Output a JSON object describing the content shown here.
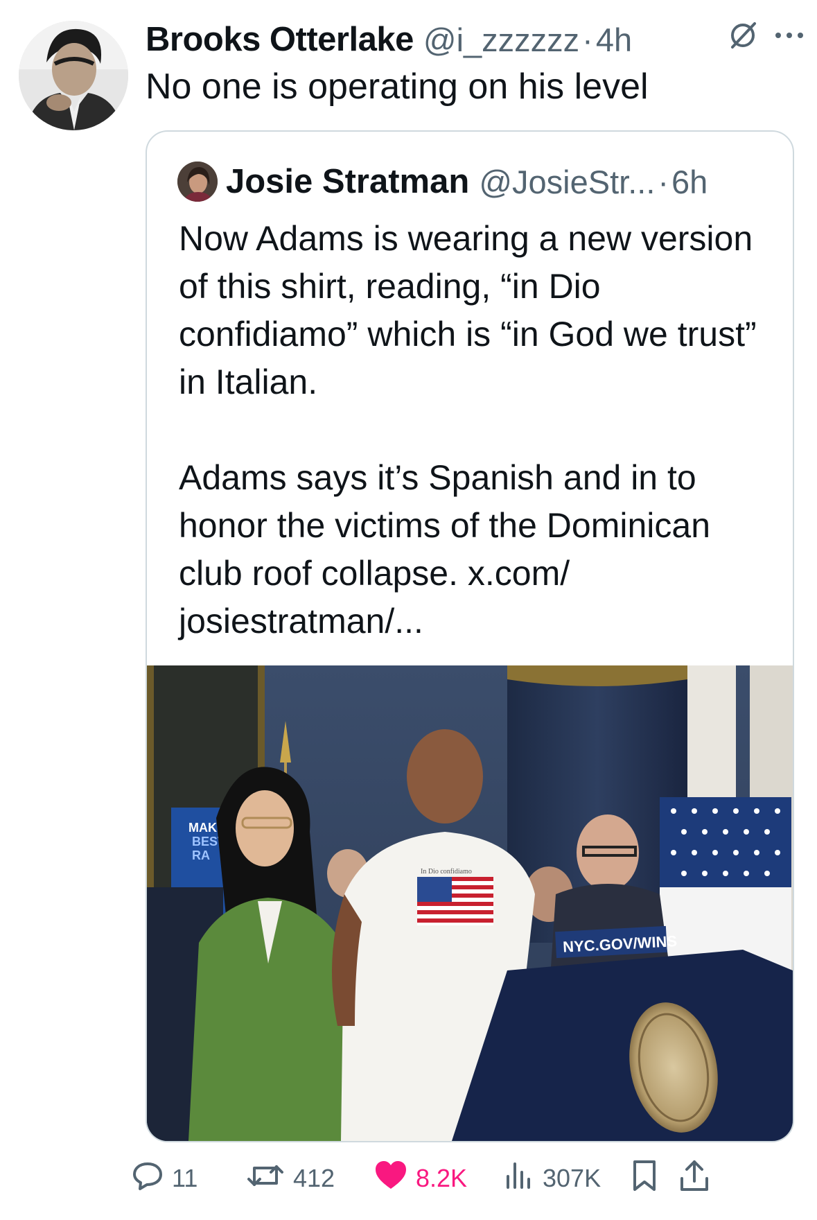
{
  "post": {
    "author_name": "Brooks Otterlake",
    "handle": "@i_zzzzzz",
    "separator": "·",
    "time": "4h",
    "text": "No one is operating on his level"
  },
  "quote": {
    "author_name": "Josie Stratman",
    "handle": "@JosieStr...",
    "separator": "·",
    "time": "6h",
    "paragraphs": [
      "Now Adams is wearing a new version of this shirt, reading, “in Dio confidiamo” which is “in God we trust” in Italian.",
      "Adams says it’s Spanish and in to honor the victims of the Dominican club roof collapse. x.com/ josiestratman/..."
    ],
    "photo": {
      "sign_text": "MAKIN\nBEST\nRA",
      "shirt_text": "In Dio confidiamo",
      "podium_sign": "NYC.GOV/WINS"
    }
  },
  "actions": {
    "replies": "11",
    "reposts": "412",
    "likes": "8.2K",
    "views": "307K"
  },
  "icons": {
    "more": "more-icon",
    "grok": "grok-icon",
    "reply": "reply-icon",
    "repost": "repost-icon",
    "like": "heart-icon",
    "views": "views-icon",
    "bookmark": "bookmark-icon",
    "share": "share-icon"
  },
  "colors": {
    "like": "#f91880",
    "secondary_text": "#536471",
    "border": "#cfd9de"
  }
}
